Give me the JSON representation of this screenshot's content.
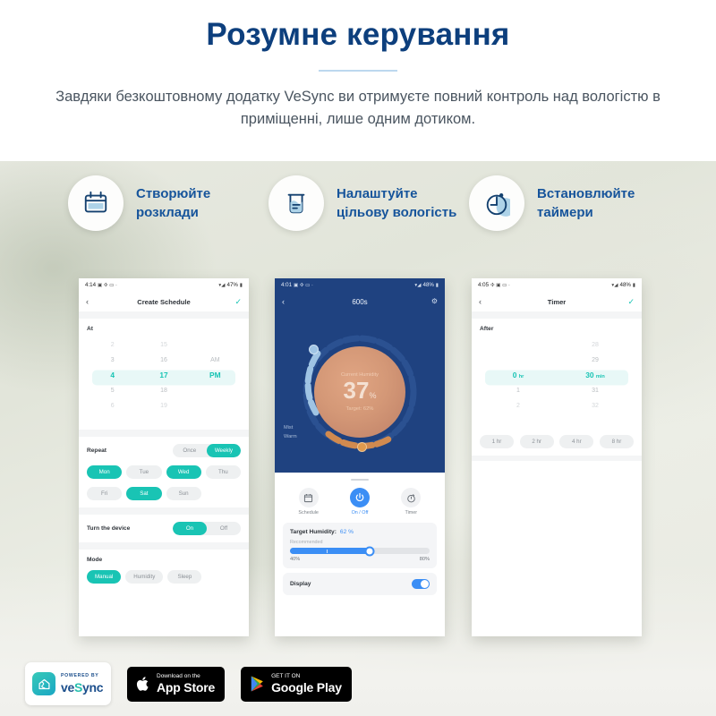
{
  "header": {
    "title": "Розумне керування",
    "subtitle": "Завдяки безкоштовному додатку VeSync ви отримуєте повний контроль над вологістю в приміщенні, лише одним дотиком."
  },
  "features": [
    {
      "icon": "calendar-icon",
      "label": "Створюйте розклади"
    },
    {
      "icon": "beaker-humidity-icon",
      "label": "Налаштуйте цільову вологість"
    },
    {
      "icon": "timer-clock-icon",
      "label": "Встановлюйте таймери"
    }
  ],
  "phone1": {
    "status": {
      "time": "4:14",
      "battery": "47%"
    },
    "nav": {
      "back": "‹",
      "title": "Create Schedule",
      "confirm": "✓"
    },
    "at_label": "At",
    "picker": {
      "hours": [
        "2",
        "3",
        "4",
        "5",
        "6"
      ],
      "minutes": [
        "15",
        "16",
        "17",
        "18",
        "19"
      ],
      "meridiem": [
        "",
        "AM",
        "PM",
        "",
        ""
      ],
      "selected_hour": "4",
      "selected_minute": "17",
      "selected_meridiem": "PM"
    },
    "repeat": {
      "label": "Repeat",
      "options": [
        "Once",
        "Weekly"
      ],
      "selected": "Weekly"
    },
    "days": [
      {
        "label": "Mon",
        "on": true
      },
      {
        "label": "Tue",
        "on": false
      },
      {
        "label": "Wed",
        "on": true
      },
      {
        "label": "Thu",
        "on": false
      },
      {
        "label": "Fri",
        "on": false
      },
      {
        "label": "Sat",
        "on": true
      },
      {
        "label": "Sun",
        "on": false
      }
    ],
    "power": {
      "label": "Turn the device",
      "options": [
        "On",
        "Off"
      ],
      "selected": "On"
    },
    "mode": {
      "label": "Mode",
      "options": [
        "Manual",
        "Humidity",
        "Sleep"
      ],
      "selected": "Manual"
    }
  },
  "phone2": {
    "status": {
      "time": "4:01",
      "battery": "48%"
    },
    "nav": {
      "back": "‹",
      "title": "600s",
      "settings": "gear-icon"
    },
    "dial": {
      "caption": "Current Humidity",
      "value": "37",
      "unit": "%",
      "target": "Target: 62%",
      "left_labels": [
        "Mist",
        "Warm"
      ]
    },
    "actions": [
      {
        "icon": "calendar-icon",
        "label": "Schedule",
        "active": false
      },
      {
        "icon": "power-icon",
        "label": "On / Off",
        "active": true
      },
      {
        "icon": "timer-icon",
        "label": "Timer",
        "active": false
      }
    ],
    "humidity_panel": {
      "title": "Target Humidity:",
      "value": "62 %",
      "recommended": "Recommended",
      "min": "40%",
      "max": "80%"
    },
    "display_panel": {
      "label": "Display",
      "on": true
    }
  },
  "phone3": {
    "status": {
      "time": "4:05",
      "battery": "48%"
    },
    "nav": {
      "back": "‹",
      "title": "Timer",
      "confirm": "✓"
    },
    "after_label": "After",
    "picker": {
      "hours": [
        "",
        "",
        "0",
        "1",
        "2"
      ],
      "minutes": [
        "28",
        "29",
        "30",
        "31",
        "32"
      ],
      "selected_hour": "0",
      "hour_unit": "hr",
      "selected_minute": "30",
      "minute_unit": "min"
    },
    "presets": [
      "1 hr",
      "2 hr",
      "4 hr",
      "8 hr"
    ]
  },
  "footer": {
    "vesync": {
      "powered_by": "POWERED BY",
      "name_left": "ve",
      "name_mid": "S",
      "name_right": "ync"
    },
    "appstore": {
      "small": "Download on the",
      "big": "App Store"
    },
    "googleplay": {
      "small": "GET IT ON",
      "big": "Google Play"
    }
  },
  "colors": {
    "navy": "#0d3f7d",
    "teal": "#19c4b4",
    "blue": "#3b8ef5",
    "dark_blue": "#1f4280"
  }
}
